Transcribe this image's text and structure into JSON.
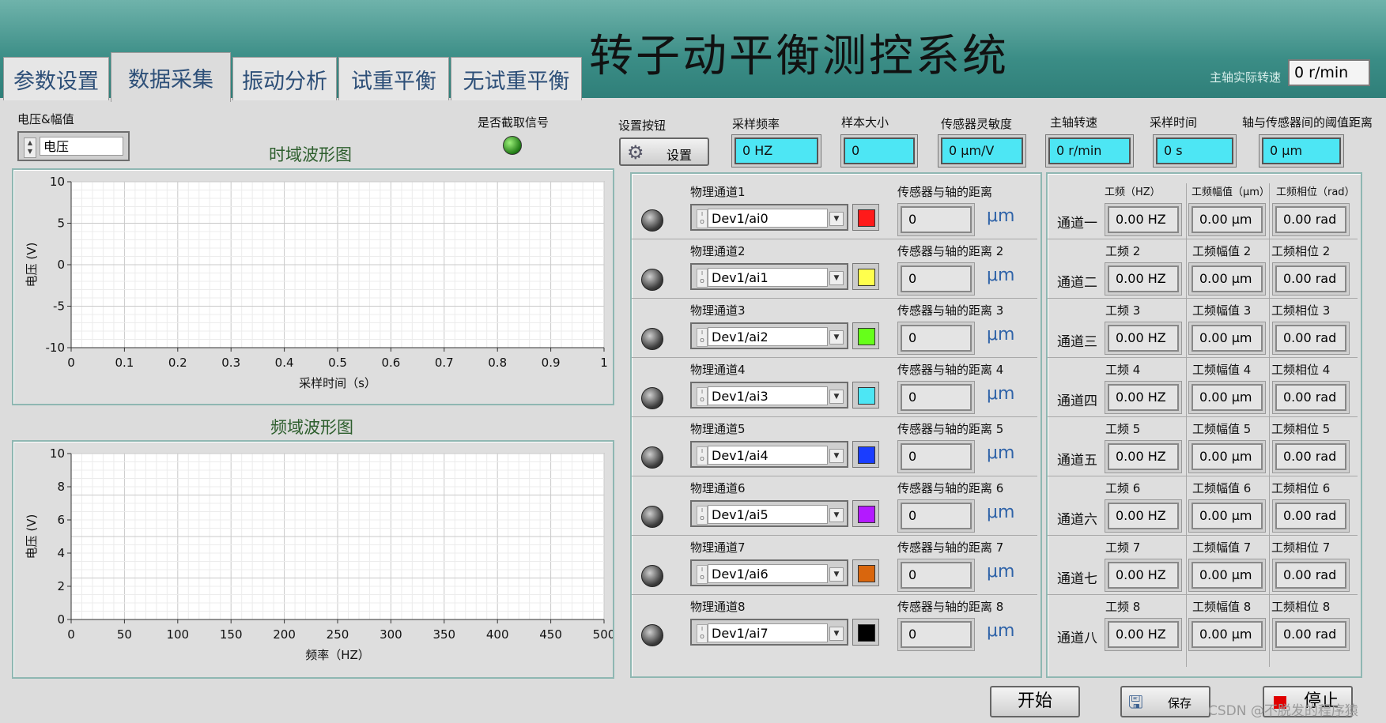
{
  "app": {
    "title": "转子动平衡测控系统"
  },
  "tabs": [
    {
      "label": "参数设置",
      "active": false
    },
    {
      "label": "数据采集",
      "active": true
    },
    {
      "label": "振动分析",
      "active": false
    },
    {
      "label": "试重平衡",
      "active": false
    },
    {
      "label": "无试重平衡",
      "active": false
    }
  ],
  "spindle_rpm": {
    "label": "主轴实际转速",
    "value": "0 r/min"
  },
  "voltage_selector": {
    "label": "电压&幅值",
    "value": "电压"
  },
  "capture_signal": {
    "label": "是否截取信号",
    "on": true
  },
  "settings": {
    "button_label": "设置按钮",
    "button_text": "设置",
    "fields": [
      {
        "label": "采样频率",
        "value": "0 HZ"
      },
      {
        "label": "样本大小",
        "value": "0"
      },
      {
        "label": "传感器灵敏度",
        "value": "0  μm/V"
      },
      {
        "label": "主轴转速",
        "value": "0  r/min"
      },
      {
        "label": "采样时间",
        "value": "0  s"
      },
      {
        "label": "轴与传感器间的阈值距离",
        "value": "0   μm"
      }
    ]
  },
  "time_plot": {
    "title": "时域波形图",
    "chart_data": {
      "type": "line",
      "xlabel": "采样时间（s）",
      "ylabel": "电压 (V)",
      "xlim": [
        0,
        1
      ],
      "ylim": [
        -10,
        10
      ],
      "x_ticks": [
        "0",
        "0.1",
        "0.2",
        "0.3",
        "0.4",
        "0.5",
        "0.6",
        "0.7",
        "0.8",
        "0.9",
        "1"
      ],
      "y_ticks": [
        "10",
        "5",
        "0",
        "-5",
        "-10"
      ],
      "grid": true,
      "series": []
    }
  },
  "freq_plot": {
    "title": "频域波形图",
    "chart_data": {
      "type": "line",
      "xlabel": "频率（HZ）",
      "ylabel": "电压 (V)",
      "xlim": [
        0,
        500
      ],
      "ylim": [
        0,
        10
      ],
      "x_ticks": [
        "0",
        "50",
        "100",
        "150",
        "200",
        "250",
        "300",
        "350",
        "400",
        "450",
        "500"
      ],
      "y_ticks": [
        "10",
        "8",
        "6",
        "4",
        "2",
        "0"
      ],
      "grid": true,
      "series": []
    }
  },
  "channels": [
    {
      "phys_label": "物理通道1",
      "device": "Dev1/ai0",
      "color": "#ff1a1a",
      "dist_label": "传感器与轴的距离",
      "dist": "0",
      "unit": "μm"
    },
    {
      "phys_label": "物理通道2",
      "device": "Dev1/ai1",
      "color": "#ffff4d",
      "dist_label": "传感器与轴的距离 2",
      "dist": "0",
      "unit": "μm"
    },
    {
      "phys_label": "物理通道3",
      "device": "Dev1/ai2",
      "color": "#66ff1a",
      "dist_label": "传感器与轴的距离 3",
      "dist": "0",
      "unit": "μm"
    },
    {
      "phys_label": "物理通道4",
      "device": "Dev1/ai3",
      "color": "#4de6f4",
      "dist_label": "传感器与轴的距离 4",
      "dist": "0",
      "unit": "μm"
    },
    {
      "phys_label": "物理通道5",
      "device": "Dev1/ai4",
      "color": "#1a3dff",
      "dist_label": "传感器与轴的距离 5",
      "dist": "0",
      "unit": "μm"
    },
    {
      "phys_label": "物理通道6",
      "device": "Dev1/ai5",
      "color": "#b31aff",
      "dist_label": "传感器与轴的距离 6",
      "dist": "0",
      "unit": "μm"
    },
    {
      "phys_label": "物理通道7",
      "device": "Dev1/ai6",
      "color": "#d9660d",
      "dist_label": "传感器与轴的距离 7",
      "dist": "0",
      "unit": "μm"
    },
    {
      "phys_label": "物理通道8",
      "device": "Dev1/ai7",
      "color": "#000000",
      "dist_label": "传感器与轴的距离 8",
      "dist": "0",
      "unit": "μm"
    }
  ],
  "results": [
    {
      "name": "通道一",
      "freq_label": "工频（HZ）",
      "freq": "0.00  HZ",
      "amp_label": "工频幅值（μm）",
      "amp": "0.00  μm",
      "phase_label": "工频相位（rad）",
      "phase": "0.00 rad"
    },
    {
      "name": "通道二",
      "freq_label": "工频 2",
      "freq": "0.00  HZ",
      "amp_label": "工频幅值 2",
      "amp": "0.00  μm",
      "phase_label": "工频相位 2",
      "phase": "0.00  rad"
    },
    {
      "name": "通道三",
      "freq_label": "工频 3",
      "freq": "0.00  HZ",
      "amp_label": "工频幅值 3",
      "amp": "0.00  μm",
      "phase_label": "工频相位 3",
      "phase": "0.00  rad"
    },
    {
      "name": "通道四",
      "freq_label": "工频 4",
      "freq": "0.00  HZ",
      "amp_label": "工频幅值 4",
      "amp": "0.00  μm",
      "phase_label": "工频相位 4",
      "phase": "0.00  rad"
    },
    {
      "name": "通道五",
      "freq_label": "工频 5",
      "freq": "0.00  HZ",
      "amp_label": "工频幅值 5",
      "amp": "0.00  μm",
      "phase_label": "工频相位 5",
      "phase": "0.00  rad"
    },
    {
      "name": "通道六",
      "freq_label": "工频 6",
      "freq": "0.00  HZ",
      "amp_label": "工频幅值 6",
      "amp": "0.00  μm",
      "phase_label": "工频相位 6",
      "phase": "0.00  rad"
    },
    {
      "name": "通道七",
      "freq_label": "工频 7",
      "freq": "0.00  HZ",
      "amp_label": "工频幅值 7",
      "amp": "0.00  μm",
      "phase_label": "工频相位 7",
      "phase": "0.00  rad"
    },
    {
      "name": "通道八",
      "freq_label": "工频 8",
      "freq": "0.00  HZ",
      "amp_label": "工频幅值 8",
      "amp": "0.00  μm",
      "phase_label": "工频相位 8",
      "phase": "0.00  rad"
    }
  ],
  "buttons": {
    "start": "开始",
    "save": "保存",
    "stop": "停止"
  },
  "watermark": "CSDN @不脱发的程序猿"
}
